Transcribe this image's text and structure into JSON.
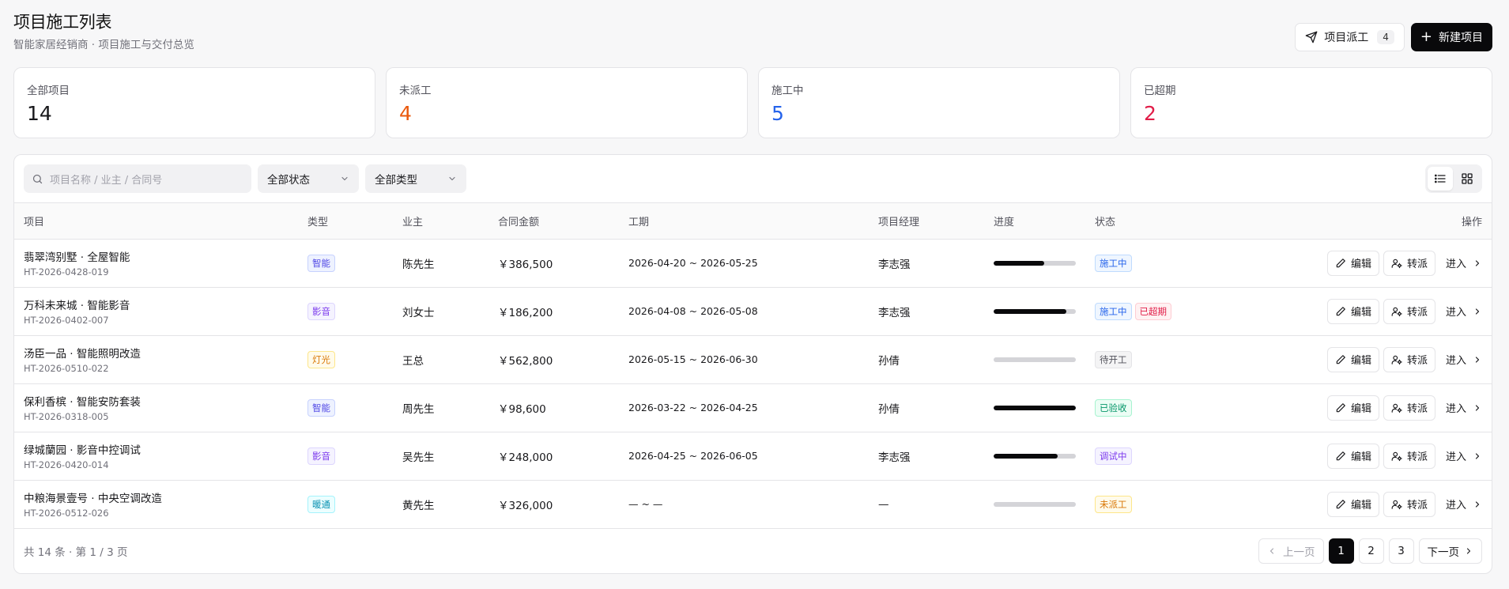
{
  "header": {
    "title": "项目施工列表",
    "subtitle": "智能家居经销商 · 项目施工与交付总览",
    "dispatch_label": "项目派工",
    "dispatch_count": "4",
    "new_label": "新建项目"
  },
  "stats": [
    {
      "label": "全部项目",
      "value": "14",
      "color": "#18181b"
    },
    {
      "label": "未派工",
      "value": "4",
      "color": "#ea580c"
    },
    {
      "label": "施工中",
      "value": "5",
      "color": "#2563eb"
    },
    {
      "label": "已超期",
      "value": "2",
      "color": "#e11d48"
    }
  ],
  "toolbar": {
    "search_placeholder": "项目名称 / 业主 / 合同号",
    "status_filter": "全部状态",
    "type_filter": "全部类型"
  },
  "columns": {
    "name": "项目",
    "type": "类型",
    "owner": "业主",
    "amount": "合同金额",
    "period": "工期",
    "manager": "项目经理",
    "progress": "进度",
    "status": "状态",
    "ops": "操作"
  },
  "actions": {
    "edit": "编辑",
    "reassign": "转派",
    "enter": "进入"
  },
  "rows": [
    {
      "name": "翡翠湾别墅 · 全屋智能",
      "code": "HT-2026-0428-019",
      "type": "智能",
      "owner": "陈先生",
      "amount": "￥386,500",
      "period": "2026-04-20 ~ 2026-05-25",
      "manager": "李志强",
      "progress": 0.62,
      "statuses": [
        "施工中"
      ]
    },
    {
      "name": "万科未来城 · 智能影音",
      "code": "HT-2026-0402-007",
      "type": "影音",
      "owner": "刘女士",
      "amount": "￥186,200",
      "period": "2026-04-08 ~ 2026-05-08",
      "manager": "李志强",
      "progress": 0.88,
      "statuses": [
        "施工中",
        "已超期"
      ]
    },
    {
      "name": "汤臣一品 · 智能照明改造",
      "code": "HT-2026-0510-022",
      "type": "灯光",
      "owner": "王总",
      "amount": "￥562,800",
      "period": "2026-05-15 ~ 2026-06-30",
      "manager": "孙倩",
      "progress": 0,
      "statuses": [
        "待开工"
      ]
    },
    {
      "name": "保利香槟 · 智能安防套装",
      "code": "HT-2026-0318-005",
      "type": "智能",
      "owner": "周先生",
      "amount": "￥98,600",
      "period": "2026-03-22 ~ 2026-04-25",
      "manager": "孙倩",
      "progress": 1.0,
      "statuses": [
        "已验收"
      ]
    },
    {
      "name": "绿城蘭园 · 影音中控调试",
      "code": "HT-2026-0420-014",
      "type": "影音",
      "owner": "吴先生",
      "amount": "￥248,000",
      "period": "2026-04-25 ~ 2026-06-05",
      "manager": "李志强",
      "progress": 0.78,
      "statuses": [
        "调试中"
      ]
    },
    {
      "name": "中粮海景壹号 · 中央空调改造",
      "code": "HT-2026-0512-026",
      "type": "暖通",
      "owner": "黄先生",
      "amount": "￥326,000",
      "period": "— ~ —",
      "manager": "—",
      "progress": 0,
      "statuses": [
        "未派工"
      ]
    }
  ],
  "tag_colors": {
    "智能": {
      "bg": "#eef2ff",
      "fg": "#4f46e5",
      "bd": "#c7d2fe"
    },
    "影音": {
      "bg": "#f5f3ff",
      "fg": "#7c3aed",
      "bd": "#ddd6fe"
    },
    "灯光": {
      "bg": "#fffbeb",
      "fg": "#d97706",
      "bd": "#fde68a"
    },
    "暖通": {
      "bg": "#ecfeff",
      "fg": "#0891b2",
      "bd": "#a5f3fc"
    },
    "施工中": {
      "bg": "#eff6ff",
      "fg": "#2563eb",
      "bd": "#bfdbfe"
    },
    "已超期": {
      "bg": "#fff1f2",
      "fg": "#e11d48",
      "bd": "#fecdd3"
    },
    "待开工": {
      "bg": "#f4f4f5",
      "fg": "#52525b",
      "bd": "#e4e4e7"
    },
    "已验收": {
      "bg": "#ecfdf5",
      "fg": "#059669",
      "bd": "#a7f3d0"
    },
    "调试中": {
      "bg": "#f5f3ff",
      "fg": "#7c3aed",
      "bd": "#ddd6fe"
    },
    "未派工": {
      "bg": "#fffbeb",
      "fg": "#d97706",
      "bd": "#fde68a"
    }
  },
  "footer": {
    "summary": "共 14 条 · 第 1 / 3 页",
    "prev": "上一页",
    "next": "下一页",
    "pages": [
      "1",
      "2",
      "3"
    ],
    "current_page": "1"
  }
}
